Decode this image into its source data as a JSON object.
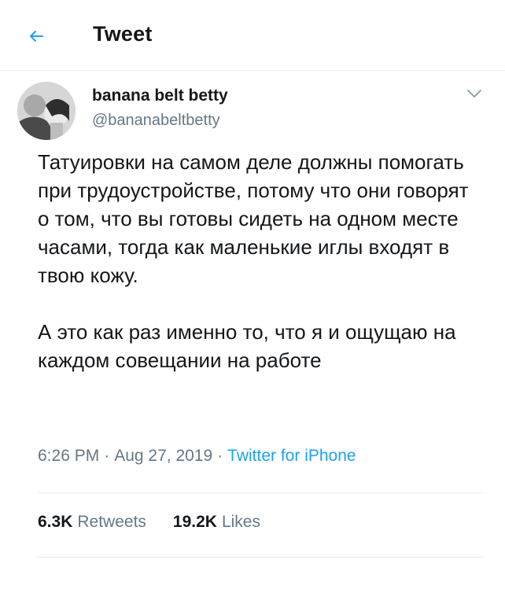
{
  "header": {
    "back_icon": "arrow-left-icon",
    "title": "Tweet"
  },
  "tweet": {
    "author": {
      "display_name": "banana belt betty",
      "handle": "@bananabeltbetty"
    },
    "more_icon": "chevron-down-icon",
    "text_lines": [
      "Татуировки на самом деле должны помогать при трудоустройстве, потому что они говорят о том, что вы готовы сидеть на одном месте часами, тогда как маленькие иглы входят в твою кожу.",
      "А это как раз именно то, что я и ощущаю на каждом совещании на работе"
    ],
    "time": "6:26 PM",
    "date": "Aug 27, 2019",
    "separator": "·",
    "source": "Twitter for iPhone",
    "retweets_count": "6.3K",
    "retweets_label": "Retweets",
    "likes_count": "19.2K",
    "likes_label": "Likes"
  },
  "colors": {
    "accent": "#1da1f2",
    "secondary_text": "#657786",
    "divider": "#e6ecf0"
  }
}
